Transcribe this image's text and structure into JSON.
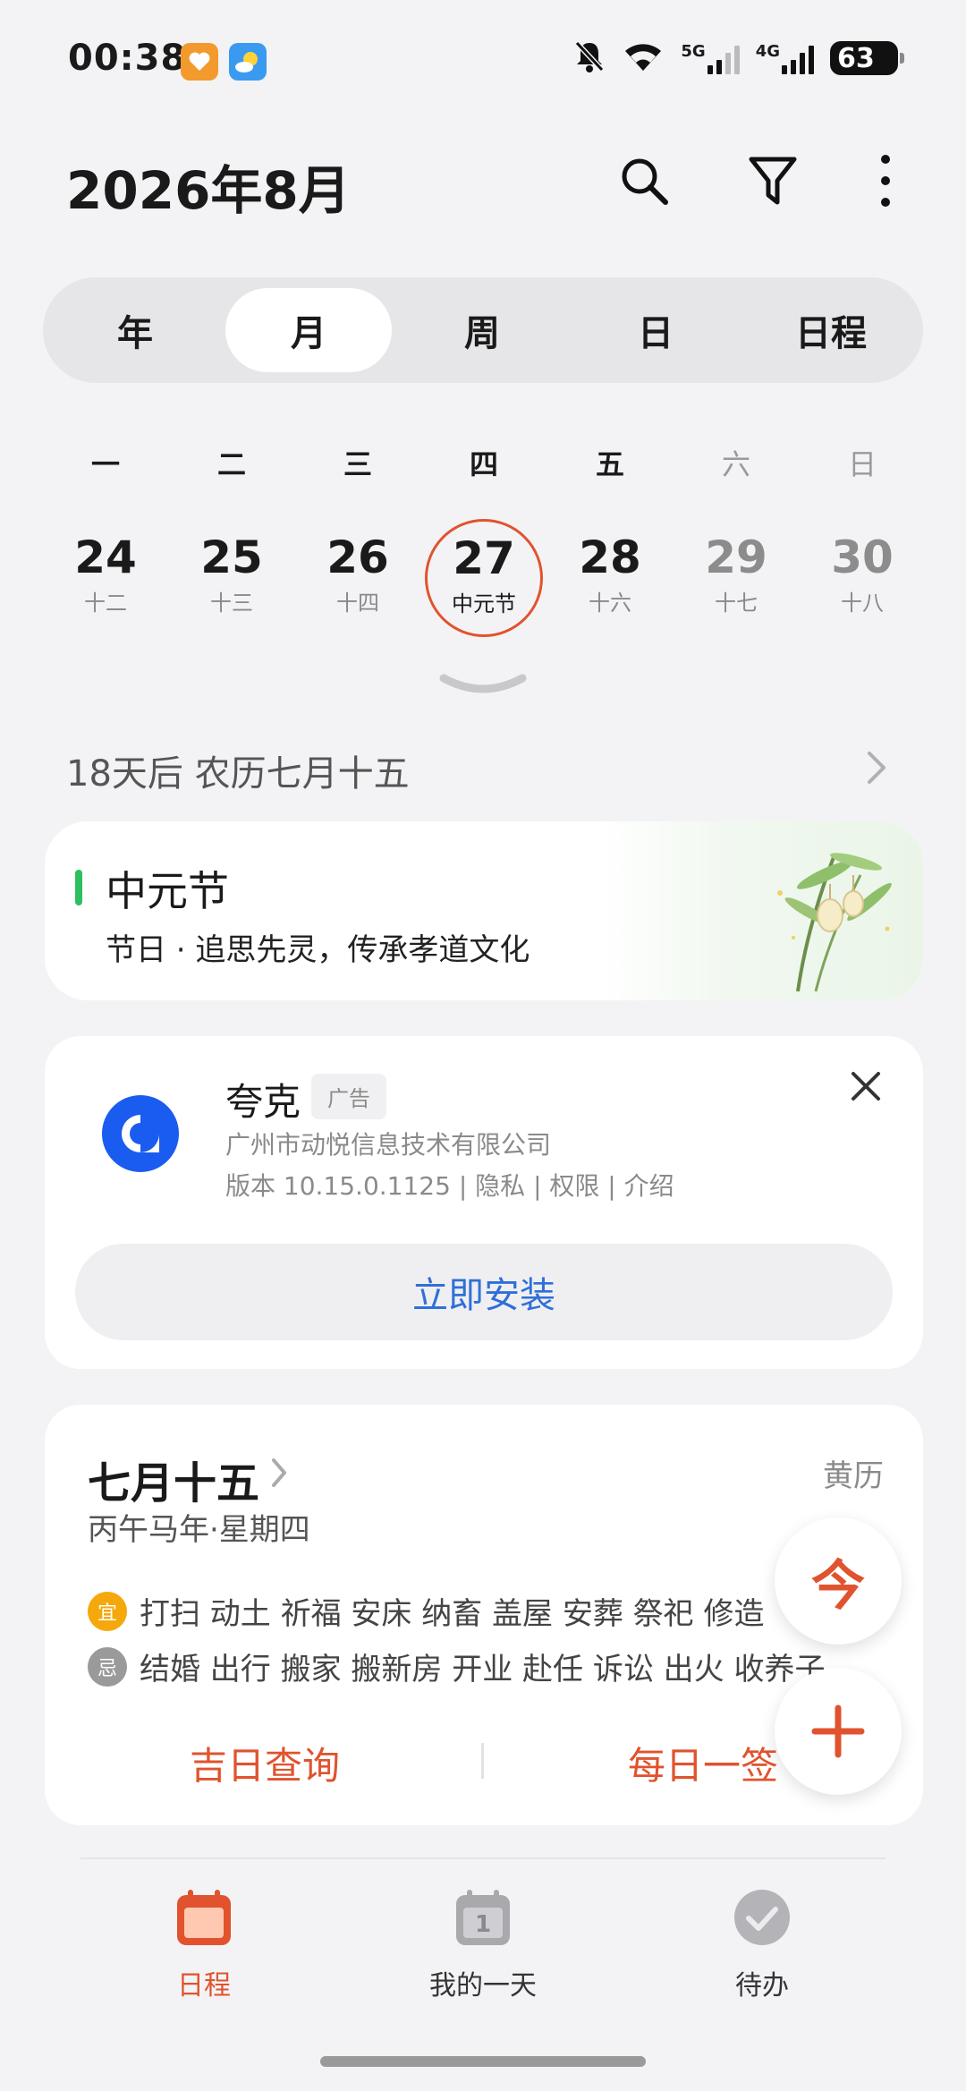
{
  "status_bar": {
    "time": "00:38",
    "network_1": "5G",
    "network_2": "4G",
    "battery": "63"
  },
  "header": {
    "title": "2026年8月"
  },
  "view_tabs": [
    "年",
    "月",
    "周",
    "日",
    "日程"
  ],
  "active_view": "月",
  "week": {
    "weekdays": [
      "一",
      "二",
      "三",
      "四",
      "五",
      "六",
      "日"
    ],
    "days": [
      {
        "num": "24",
        "lunar": "十二"
      },
      {
        "num": "25",
        "lunar": "十三"
      },
      {
        "num": "26",
        "lunar": "十四"
      },
      {
        "num": "27",
        "lunar": "中元节"
      },
      {
        "num": "28",
        "lunar": "十六"
      },
      {
        "num": "29",
        "lunar": "十七"
      },
      {
        "num": "30",
        "lunar": "十八"
      }
    ]
  },
  "countdown": "18天后 农历七月十五",
  "festival": {
    "name": "中元节",
    "desc": "节日 · 追思先灵，传承孝道文化"
  },
  "ad": {
    "app_name": "夸克",
    "tag": "广告",
    "company": "广州市动悦信息技术有限公司",
    "meta": "版本 10.15.0.1125 | 隐私 | 权限 | 介绍",
    "install": "立即安装"
  },
  "almanac": {
    "date": "七月十五",
    "sub": "丙午马年·星期四",
    "link": "黄历",
    "good_badge": "宜",
    "good": "打扫 动土 祈福 安床 纳畜 盖屋 安葬 祭祀 修造",
    "bad_badge": "忌",
    "bad": "结婚 出行 搬家 搬新房 开业 赴任 诉讼 出火 收养子",
    "btn_left": "吉日查询",
    "btn_right": "每日一签"
  },
  "fab_today": "今",
  "bottom_nav": {
    "schedule": "日程",
    "my_day": "我的一天",
    "my_day_icon_num": "1",
    "todo": "待办"
  },
  "colors": {
    "accent": "#e0532e",
    "good": "#f5a80c",
    "festival_bar": "#2fbf60",
    "link_blue": "#2f6fd9"
  }
}
